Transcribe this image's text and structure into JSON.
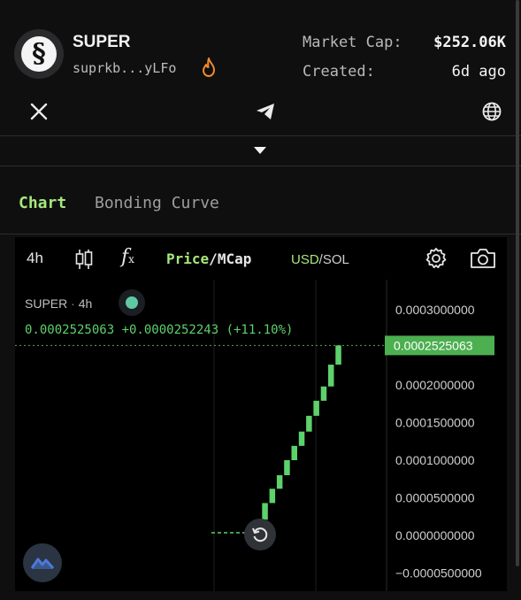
{
  "token": {
    "name": "SUPER",
    "address": "suprkb...yLFo",
    "logo_glyph": "§"
  },
  "stats": {
    "market_cap_label": "Market Cap:",
    "market_cap_value": "$252.06K",
    "created_label": "Created:",
    "created_value": "6d ago"
  },
  "tabs": {
    "chart": "Chart",
    "bonding_curve": "Bonding Curve"
  },
  "toolbar": {
    "interval": "4h",
    "price": "Price",
    "sep1": "/",
    "mcap": "MCap",
    "usd": "USD",
    "sep2": "/",
    "sol": "SOL"
  },
  "legend": {
    "symbol": "SUPER",
    "dot": "·",
    "interval": "4h",
    "ohlc": "0.0002525063 +0.0000252243 (+11.10%)"
  },
  "colors": {
    "accent": "#a5e87c",
    "up": "#5dd16b",
    "price_tag": "#4caf50"
  },
  "chart_data": {
    "type": "candlestick",
    "y_ticks": [
      "0.0003000000",
      "0.0002000000",
      "0.0001500000",
      "0.0001000000",
      "0.0000500000",
      "0.0000000000",
      "−0.0000500000"
    ],
    "last_price_label": "0.0002525063",
    "last_price": 0.0002525063,
    "candles": [
      {
        "open": 0.0,
        "close": 2.1e-05
      },
      {
        "open": 2.1e-05,
        "close": 4.3e-05
      },
      {
        "open": 4.3e-05,
        "close": 6.2e-05
      },
      {
        "open": 6.2e-05,
        "close": 8e-05
      },
      {
        "open": 8e-05,
        "close": 0.0001
      },
      {
        "open": 0.0001,
        "close": 0.000119
      },
      {
        "open": 0.000119,
        "close": 0.000138
      },
      {
        "open": 0.000138,
        "close": 0.000159
      },
      {
        "open": 0.000159,
        "close": 0.000179
      },
      {
        "open": 0.000179,
        "close": 0.000198
      },
      {
        "open": 0.000198,
        "close": 0.000227
      },
      {
        "open": 0.000227,
        "close": 0.0002525
      }
    ],
    "ylim": [
      -5e-05,
      0.0003
    ]
  }
}
